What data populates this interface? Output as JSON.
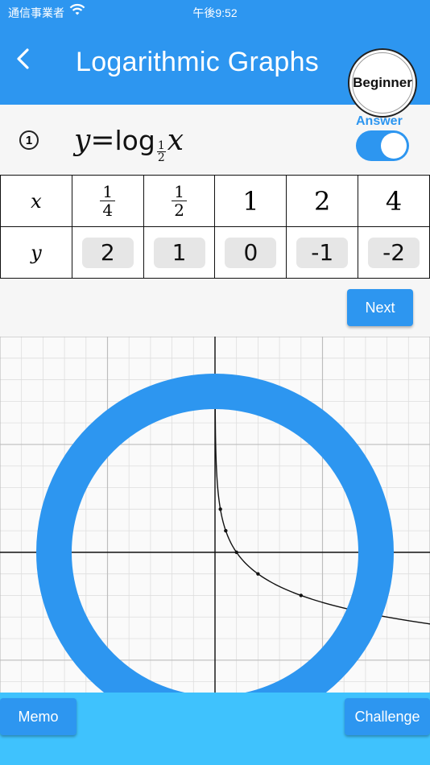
{
  "status_bar": {
    "carrier": "通信事業者",
    "time": "午後9:52"
  },
  "header": {
    "title": "Logarithmic Graphs",
    "level_badge": "Beginner"
  },
  "question": {
    "number": "1",
    "formula": {
      "y": "y",
      "eq": "=",
      "log": "log",
      "base_num": "1",
      "base_den": "2",
      "x": "x"
    },
    "answer_label": "Answer",
    "answer_toggle_on": true
  },
  "table": {
    "x_label": "x",
    "y_label": "y",
    "x_values": [
      {
        "num": "1",
        "den": "4"
      },
      {
        "num": "1",
        "den": "2"
      },
      {
        "text": "1"
      },
      {
        "text": "2"
      },
      {
        "text": "4"
      }
    ],
    "y_values": [
      "2",
      "1",
      "0",
      "-1",
      "-2"
    ]
  },
  "buttons": {
    "next": "Next",
    "memo": "Memo",
    "challenge": "Challenge"
  },
  "chart_data": {
    "type": "line",
    "series": [
      {
        "x": [
          0.25,
          0.5,
          1,
          2,
          4
        ],
        "y": [
          2,
          1,
          0,
          -1,
          -2
        ]
      }
    ],
    "xlim": [
      -10,
      10
    ],
    "ylim": [
      -6.5,
      10
    ],
    "grid": true,
    "point_color": "#111111",
    "overlay_circle_color": "#2d96f0"
  },
  "colors": {
    "primary": "#2d96f0",
    "footer": "#3fc2fd",
    "cell_bg": "#e6e6e6"
  }
}
